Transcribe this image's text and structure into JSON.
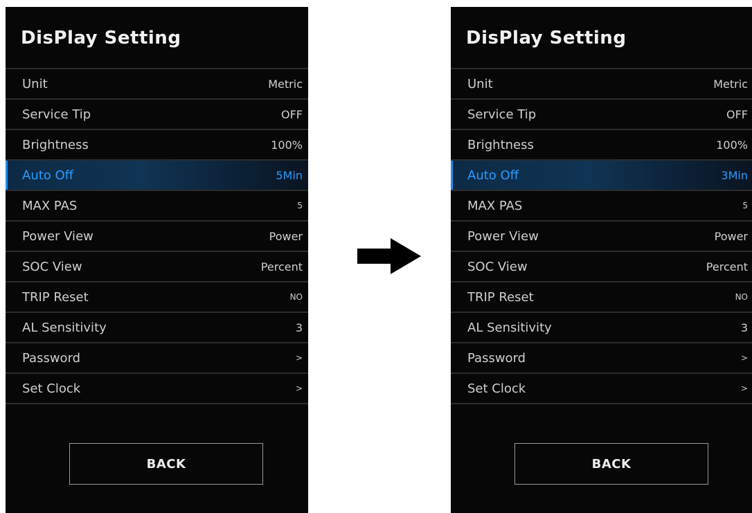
{
  "screens": [
    {
      "title": "DisPlay Setting",
      "rows": [
        {
          "label": "Unit",
          "value": "Metric"
        },
        {
          "label": "Service Tip",
          "value": "OFF"
        },
        {
          "label": "Brightness",
          "value": "100%"
        },
        {
          "label": "Auto Off",
          "value": "5Min"
        },
        {
          "label": "MAX PAS",
          "value": "5"
        },
        {
          "label": "Power View",
          "value": "Power"
        },
        {
          "label": "SOC View",
          "value": "Percent"
        },
        {
          "label": "TRIP Reset",
          "value": "NO"
        },
        {
          "label": "AL Sensitivity",
          "value": "3"
        },
        {
          "label": "Password",
          "value": ">"
        },
        {
          "label": "Set Clock",
          "value": ">"
        }
      ],
      "back_label": "BACK"
    },
    {
      "title": "DisPlay Setting",
      "rows": [
        {
          "label": "Unit",
          "value": "Metric"
        },
        {
          "label": "Service Tip",
          "value": "OFF"
        },
        {
          "label": "Brightness",
          "value": "100%"
        },
        {
          "label": "Auto Off",
          "value": "3Min"
        },
        {
          "label": "MAX PAS",
          "value": "5"
        },
        {
          "label": "Power View",
          "value": "Power"
        },
        {
          "label": "SOC View",
          "value": "Percent"
        },
        {
          "label": "TRIP Reset",
          "value": "NO"
        },
        {
          "label": "AL Sensitivity",
          "value": "3"
        },
        {
          "label": "Password",
          "value": ">"
        },
        {
          "label": "Set Clock",
          "value": ">"
        }
      ],
      "back_label": "BACK"
    }
  ],
  "selected_row": "Auto Off",
  "transition_icon": "right-arrow-icon",
  "colors": {
    "screen_background": "#070707",
    "selected_accent": "#2a9bff",
    "divider": "#2c2c2c"
  }
}
